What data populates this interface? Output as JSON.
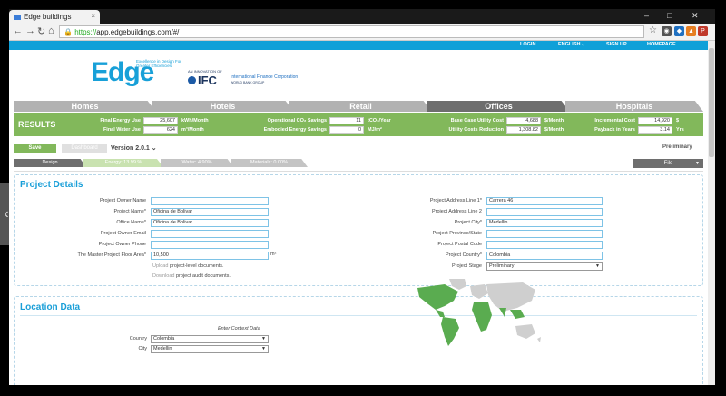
{
  "browser": {
    "tab_title": "Edge buildings",
    "url_scheme": "https://",
    "url_host": "app.edgebuildings.com/#/"
  },
  "topnav": {
    "login": "LOGIN",
    "language": "ENGLISH",
    "signup": "SIGN UP",
    "homepage": "HOMEPAGE"
  },
  "logo": {
    "edge": "Edge",
    "tagline": "Excellence in Design For Greater Efficiencies",
    "ifc_small": "AN INNOVATION OF",
    "ifc": "IFC",
    "ifc_name": "International Finance Corporation",
    "ifc_group": "WORLD BANK GROUP"
  },
  "categories": [
    {
      "label": "Homes",
      "active": false
    },
    {
      "label": "Hotels",
      "active": false
    },
    {
      "label": "Retail",
      "active": false
    },
    {
      "label": "Offices",
      "active": true
    },
    {
      "label": "Hospitals",
      "active": false
    }
  ],
  "results": {
    "title": "RESULTS",
    "items": [
      {
        "label": "Final Energy Use",
        "value": "25,607",
        "unit": "kWh/Month"
      },
      {
        "label": "Final Water Use",
        "value": "624",
        "unit": "m³/Month"
      },
      {
        "label": "Operational CO₂ Savings",
        "value": "11",
        "unit": "tCO₂/Year"
      },
      {
        "label": "Embodied Energy Savings",
        "value": "0",
        "unit": "MJ/m²"
      },
      {
        "label": "Base Case Utility Cost",
        "value": "4,688",
        "unit": "$/Month"
      },
      {
        "label": "Utility Costs Reduction",
        "value": "1,308.82",
        "unit": "$/Month"
      },
      {
        "label": "Incremental Cost",
        "value": "14,920",
        "unit": "$"
      },
      {
        "label": "Payback in Years",
        "value": "3.14",
        "unit": "Yrs"
      }
    ]
  },
  "actions": {
    "save": "Save",
    "dashboard": "Dashboard",
    "version": "Version 2.0.1",
    "status": "Preliminary"
  },
  "steps": [
    {
      "label": "Design",
      "color": "#6e6e6e"
    },
    {
      "label": "Energy: 13.99 %",
      "color": "#c9e2b0"
    },
    {
      "label": "Water: 4.90%",
      "color": "#c4c4c4"
    },
    {
      "label": "Materials: 0.00%",
      "color": "#c4c4c4"
    }
  ],
  "file_button": "File",
  "project": {
    "title": "Project Details",
    "left_fields": [
      {
        "label": "Project Owner Name",
        "value": ""
      },
      {
        "label": "Project Name*",
        "value": "Oficina de Bolivar"
      },
      {
        "label": "Office Name*",
        "value": "Oficina de Bolivar"
      },
      {
        "label": "Project Owner Email",
        "value": ""
      },
      {
        "label": "Project Owner Phone",
        "value": ""
      },
      {
        "label": "The Master Project Floor Area*",
        "value": "10,500"
      }
    ],
    "area_unit": "m²",
    "upload_link": "Upload",
    "upload_text": "project-level documents.",
    "download_link": "Download",
    "download_text": "project audit documents.",
    "right_fields": [
      {
        "label": "Project Address Line 1*",
        "value": "Carrera 46"
      },
      {
        "label": "Project Address Line 2",
        "value": ""
      },
      {
        "label": "Project City*",
        "value": "Medellin"
      },
      {
        "label": "Project Province/State",
        "value": ""
      },
      {
        "label": "Project Postal Code",
        "value": ""
      },
      {
        "label": "Project Country*",
        "value": "Colombia"
      }
    ],
    "stage_label": "Project Stage",
    "stage_value": "Preliminary"
  },
  "location": {
    "title": "Location Data",
    "context": "Enter Context Data",
    "country_label": "Country",
    "country_value": "Colombia",
    "city_label": "City",
    "city_value": "Medellin",
    "map_color_selected": "#5aac50",
    "map_color_other": "#cfcfcf"
  }
}
